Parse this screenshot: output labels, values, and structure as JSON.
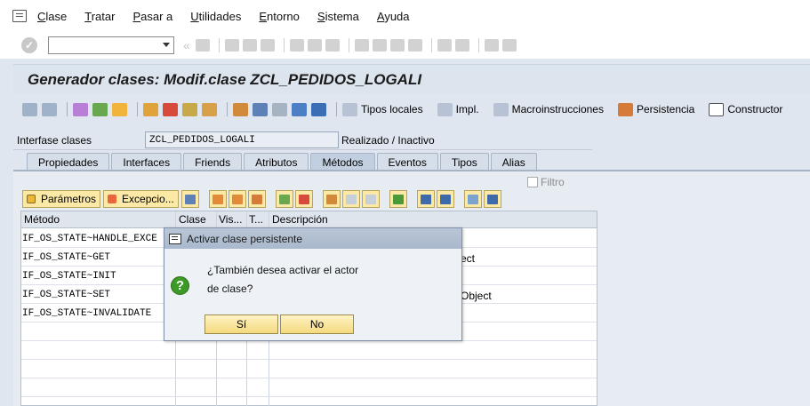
{
  "menu": {
    "items": [
      "Clase",
      "Tratar",
      "Pasar a",
      "Utilidades",
      "Entorno",
      "Sistema",
      "Ayuda"
    ]
  },
  "title": "Generador clases: Modif.clase ZCL_PEDIDOS_LOGALI",
  "app_toolbar": {
    "buttons": [
      "Tipos locales",
      "Impl.",
      "Macroinstrucciones",
      "Persistencia",
      "Constructor"
    ]
  },
  "header": {
    "label": "Interfase clases",
    "value": "ZCL_PEDIDOS_LOGALI",
    "status": "Realizado / Inactivo"
  },
  "tabs": [
    "Propiedades",
    "Interfaces",
    "Friends",
    "Atributos",
    "Métodos",
    "Eventos",
    "Tipos",
    "Alias"
  ],
  "active_tab": "Métodos",
  "methods_toolbar": {
    "params_label": "Parámetros",
    "exceptions_label": "Excepcio...",
    "filter_label": "Filtro"
  },
  "table": {
    "columns": [
      "Método",
      "Clase",
      "Vis...",
      "T...",
      "Descripción"
    ],
    "rows": [
      {
        "method": "IF_OS_STATE~HANDLE_EXCE",
        "desc": ""
      },
      {
        "method": "IF_OS_STATE~GET",
        "desc": "ect"
      },
      {
        "method": "IF_OS_STATE~INIT",
        "desc": ""
      },
      {
        "method": "IF_OS_STATE~SET",
        "desc": "Object"
      },
      {
        "method": "IF_OS_STATE~INVALIDATE",
        "desc": ""
      }
    ]
  },
  "dialog": {
    "title": "Activar clase persistente",
    "line1": "¿También desea activar el actor",
    "line2": "de clase?",
    "yes": "Sí",
    "no": "No"
  },
  "colors": {
    "title_band": "#dce4ee",
    "dialog_title": "#b9c6d7",
    "yellow_button": "#f4d97d",
    "question_icon": "#3d9a26"
  }
}
